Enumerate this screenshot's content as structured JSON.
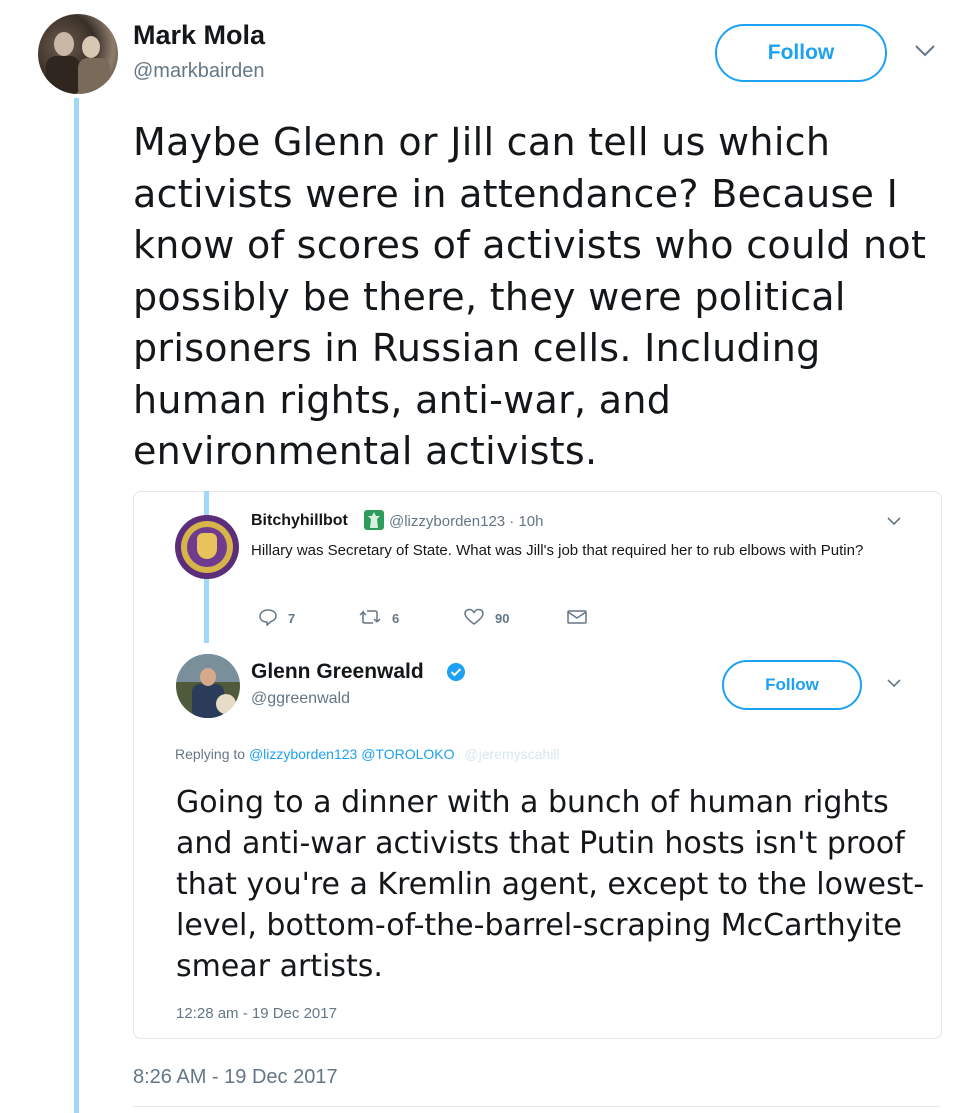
{
  "author": {
    "name": "Mark Mola",
    "handle": "@markbairden",
    "follow_label": "Follow"
  },
  "tweet": {
    "text": "Maybe Glenn or Jill can tell us which activists were in attendance? Because I know of scores of activists who could not possibly be there, they were political prisoners in Russian cells. Including human rights, anti-war, and environmental activists.",
    "timestamp": "8:26 AM - 19 Dec 2017"
  },
  "quoted_parent": {
    "name": "Bitchyhillbot",
    "meta": "@lizzyborden123 · 10h",
    "text": "Hillary was Secretary of State. What was Jill's job that required her to rub elbows with Putin?",
    "actions": {
      "replies": "7",
      "retweets": "6",
      "likes": "90"
    }
  },
  "quoted_tweet": {
    "name": "Glenn Greenwald",
    "handle": "@ggreenwald",
    "follow_label": "Follow",
    "replying_prefix": "Replying to",
    "mention1": "@lizzyborden123",
    "mention2": "@TOROLOKO",
    "faded_mention": "@jeremyscahill",
    "text": "Going to a dinner with a bunch of human rights and anti-war activists that Putin hosts isn't proof that you're a Kremlin agent, except to the lowest-level, bottom-of-the-barrel-scraping McCarthyite smear artists.",
    "timestamp": "12:28 am - 19 Dec 2017"
  },
  "colors": {
    "accent": "#1da1f2",
    "thread_line": "#9fd7f6",
    "muted": "#657786"
  },
  "icons": {
    "dropdown": "chevron-down-icon",
    "verified": "verified-badge-icon",
    "reply": "reply-icon",
    "retweet": "retweet-icon",
    "like": "heart-icon",
    "dm": "envelope-icon"
  }
}
